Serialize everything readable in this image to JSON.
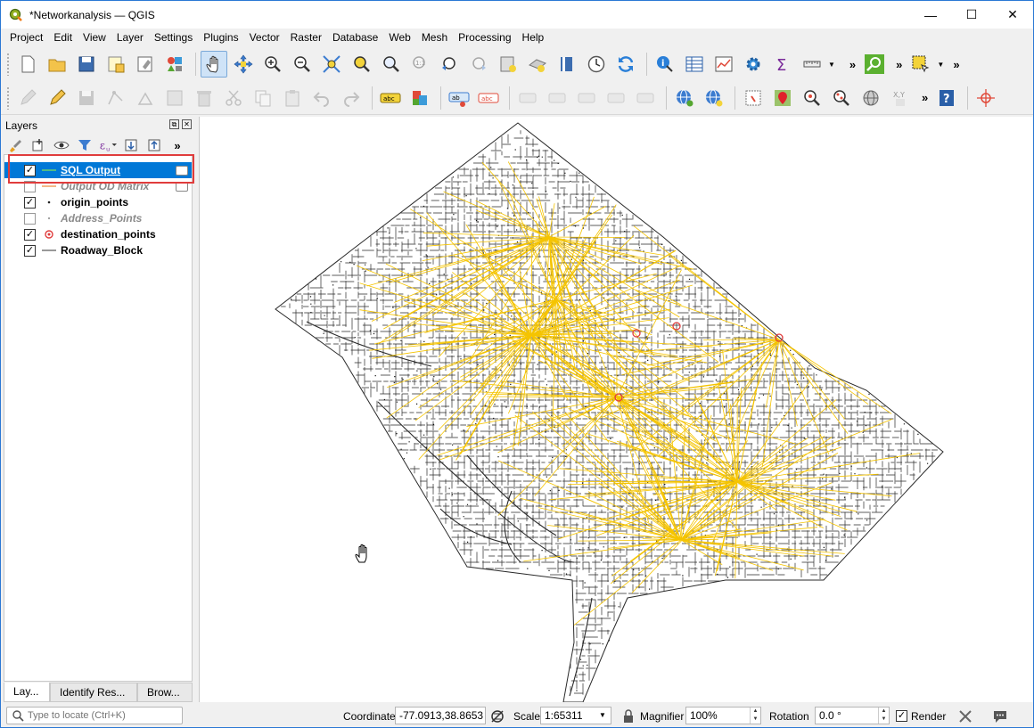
{
  "window": {
    "title": "*Networkanalysis — QGIS",
    "minimize": "—",
    "maximize": "☐",
    "close": "✕"
  },
  "menu": [
    "Project",
    "Edit",
    "View",
    "Layer",
    "Settings",
    "Plugins",
    "Vector",
    "Raster",
    "Database",
    "Web",
    "Mesh",
    "Processing",
    "Help"
  ],
  "layers_panel": {
    "title": "Layers",
    "layers": [
      {
        "name": "SQL Output",
        "checked": true,
        "selected": true,
        "style": "selected",
        "symbol": "line-green"
      },
      {
        "name": "Output OD Matrix",
        "checked": false,
        "selected": false,
        "style": "grey",
        "symbol": "line-orange"
      },
      {
        "name": "origin_points",
        "checked": true,
        "selected": false,
        "style": "bold",
        "symbol": "point-black"
      },
      {
        "name": "Address_Points",
        "checked": false,
        "selected": false,
        "style": "greyit",
        "symbol": "point-grey"
      },
      {
        "name": "destination_points",
        "checked": true,
        "selected": false,
        "style": "bold",
        "symbol": "point-red"
      },
      {
        "name": "Roadway_Block",
        "checked": true,
        "selected": false,
        "style": "bold",
        "symbol": "line-grey"
      }
    ],
    "tabs": [
      "Lay...",
      "Identify Res...",
      "Brow..."
    ]
  },
  "status": {
    "locator_placeholder": "Type to locate (Ctrl+K)",
    "coordinate_label": "Coordinate",
    "coordinate_value": "-77.0913,38.8653",
    "scale_label": "Scale",
    "scale_value": "1:65311",
    "magnifier_label": "Magnifier",
    "magnifier_value": "100%",
    "rotation_label": "Rotation",
    "rotation_value": "0.0 °",
    "render_label": "Render",
    "render_checked": true
  },
  "colors": {
    "od_lines": "#f5c400",
    "roads": "#2a2a2a",
    "destination": "#e03c3c",
    "selection": "#0078d7"
  }
}
